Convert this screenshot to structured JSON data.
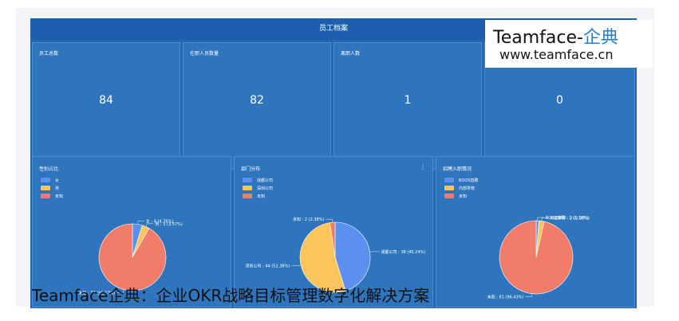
{
  "dashboard": {
    "title": "员工档案",
    "stats": [
      {
        "label": "员工总数",
        "value": "84"
      },
      {
        "label": "在职人员数量",
        "value": "82"
      },
      {
        "label": "离职人数",
        "value": "1"
      },
      {
        "label": "",
        "value": "0"
      }
    ],
    "menu_icon": "⋮"
  },
  "brand": {
    "name_latin": "Teamface-",
    "name_cn": "企典",
    "url": "www.teamface.cn",
    "accent": "#2d7fc4"
  },
  "caption": "Teamface企典：企业OKR战略目标管理数字化解决方案",
  "colors": {
    "page_bg": "#2566ad",
    "card_bg": "#2e75bd",
    "blue": "#5b8ff0",
    "yellow": "#fbc55c",
    "red": "#f07c69"
  },
  "chart_data": [
    {
      "type": "pie",
      "title": "性别占比",
      "legend": [
        "女",
        "男",
        "未知"
      ],
      "colors": [
        "#5b8ff0",
        "#fbc55c",
        "#f07c69"
      ],
      "values": [
        4,
        3,
        77
      ],
      "data_labels": [
        "女 : 4 (4.76%)",
        "男 : 3 (3.57%)",
        "未知 : 77 (91.67%)"
      ]
    },
    {
      "type": "pie",
      "title": "部门分布",
      "legend": [
        "成都公司",
        "深圳公司",
        "未知"
      ],
      "colors": [
        "#5b8ff0",
        "#fbc55c",
        "#f07c69"
      ],
      "values": [
        38,
        44,
        2
      ],
      "data_labels": [
        "成都公司 : 38 (45.24%)",
        "深圳公司 : 44 (52.38%)",
        "未知 : 2 (2.38%)"
      ]
    },
    {
      "type": "pie",
      "title": "招聘入职情况",
      "legend": [
        "BOOS直聘",
        "内部举荐",
        "未知"
      ],
      "colors": [
        "#5b8ff0",
        "#fbc55c",
        "#f07c69"
      ],
      "values": [
        1,
        2,
        81
      ],
      "data_labels": [
        "BOOS直聘 : 1 (1.19%)",
        "内部举荐 : 2 (2.38%)",
        "未知 : 81 (96.43%)"
      ]
    }
  ]
}
